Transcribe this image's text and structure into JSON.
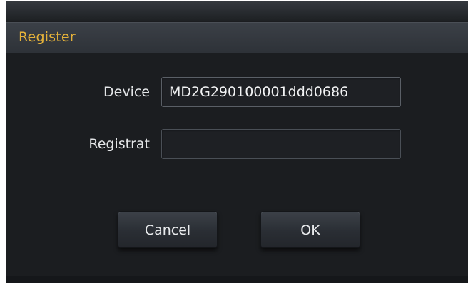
{
  "dialog": {
    "title": "Register",
    "title_color": "#e5b23a",
    "device": {
      "label": "Device",
      "value": "MD2G290100001ddd0686"
    },
    "registration": {
      "label": "Registrat",
      "value": ""
    },
    "buttons": {
      "cancel_label": "Cancel",
      "ok_label": "OK"
    }
  }
}
